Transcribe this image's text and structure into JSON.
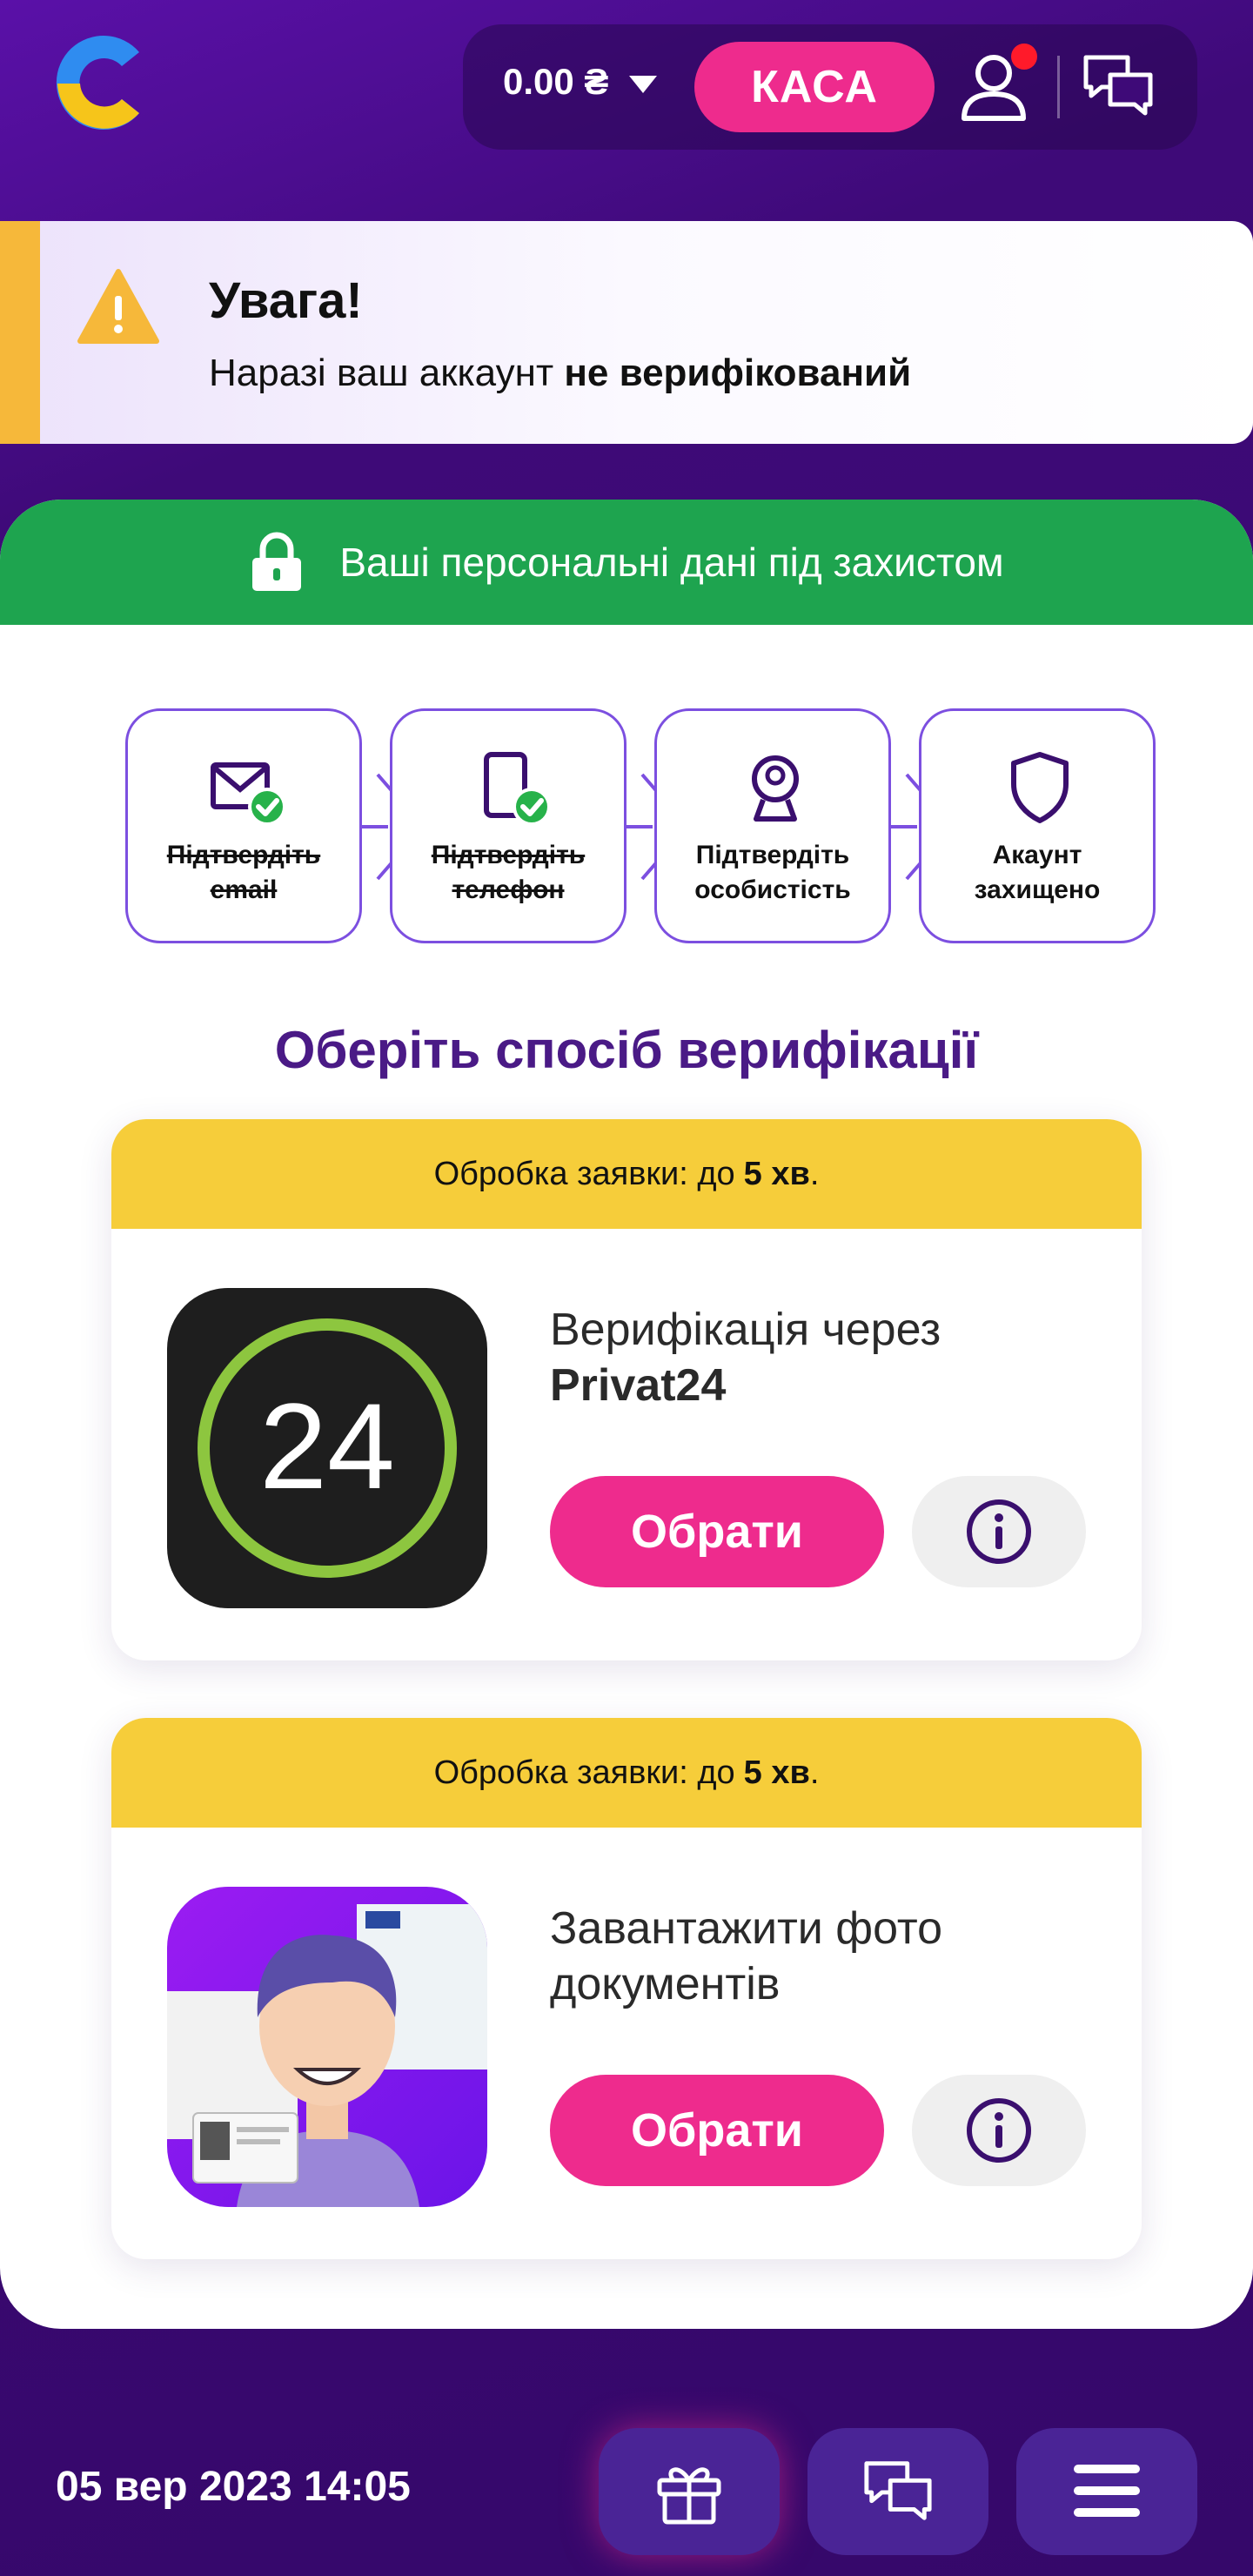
{
  "header": {
    "balance": "0.00 ₴",
    "cash_label": "КАСА"
  },
  "alert": {
    "title": "Увага!",
    "text_prefix": "Наразі ваш аккаунт ",
    "text_bold": "не верифікований"
  },
  "security_banner": "Ваші персональні дані під захистом",
  "steps": [
    {
      "line1": "Підтвердіть",
      "line2": "email",
      "done": true,
      "icon": "envelope-icon"
    },
    {
      "line1": "Підтвердіть",
      "line2": "телефон",
      "done": true,
      "icon": "phone-icon"
    },
    {
      "line1": "Підтвердіть",
      "line2": "особистість",
      "done": false,
      "icon": "person-badge-icon"
    },
    {
      "line1": "Акаунт",
      "line2": "захищено",
      "done": false,
      "icon": "shield-icon"
    }
  ],
  "section_title": "Оберіть спосіб верифікації",
  "methods": [
    {
      "processing_prefix": "Обробка заявки: до",
      "processing_time": "5 хв",
      "processing_suffix": ".",
      "title_line1": "Верифікація через",
      "title_line2": "Privat24",
      "logo_text": "24",
      "choose_label": "Обрати"
    },
    {
      "processing_prefix": "Обробка заявки: до",
      "processing_time": "5 хв",
      "processing_suffix": ".",
      "title_line1": "Завантажити фото",
      "title_line2": "документів",
      "choose_label": "Обрати"
    }
  ],
  "footer": {
    "datetime": "05 вер 2023 14:05"
  },
  "colors": {
    "accent_pink": "#ee2b8d",
    "brand_purple": "#4a1a86",
    "success_green": "#1ea44f",
    "warning_yellow": "#f6cd3a",
    "alert_orange": "#f6b83a"
  }
}
